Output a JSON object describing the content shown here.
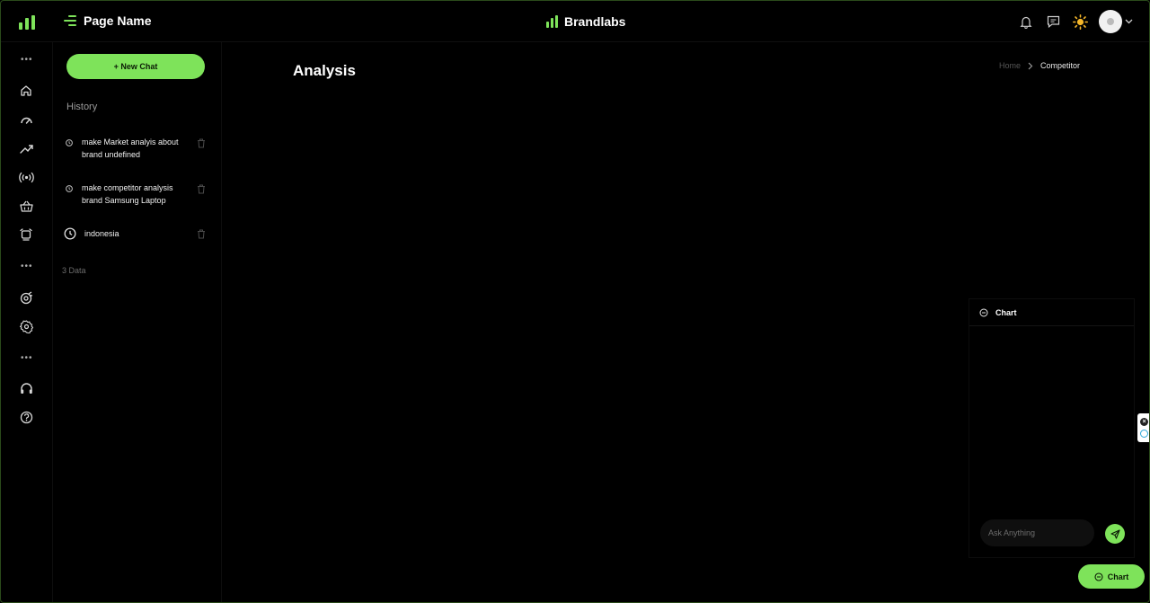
{
  "header": {
    "page_name": "Page Name",
    "brand_name": "Brandlabs"
  },
  "sidebar": {
    "new_chat_label": "+ New Chat",
    "history_title": "History",
    "history": [
      {
        "text": "make Market analyis about brand undefined"
      },
      {
        "text": "make competitor analysis brand Samsung Laptop"
      },
      {
        "text": "indonesia"
      }
    ],
    "data_count": "3 Data"
  },
  "main": {
    "title": "Analysis",
    "breadcrumb": {
      "home": "Home",
      "current": "Competitor"
    }
  },
  "chat_panel": {
    "title": "Chart",
    "input_placeholder": "Ask Anything"
  },
  "chat_fab_label": "Chart",
  "colors": {
    "accent": "#7ee35a",
    "background": "#000000"
  }
}
